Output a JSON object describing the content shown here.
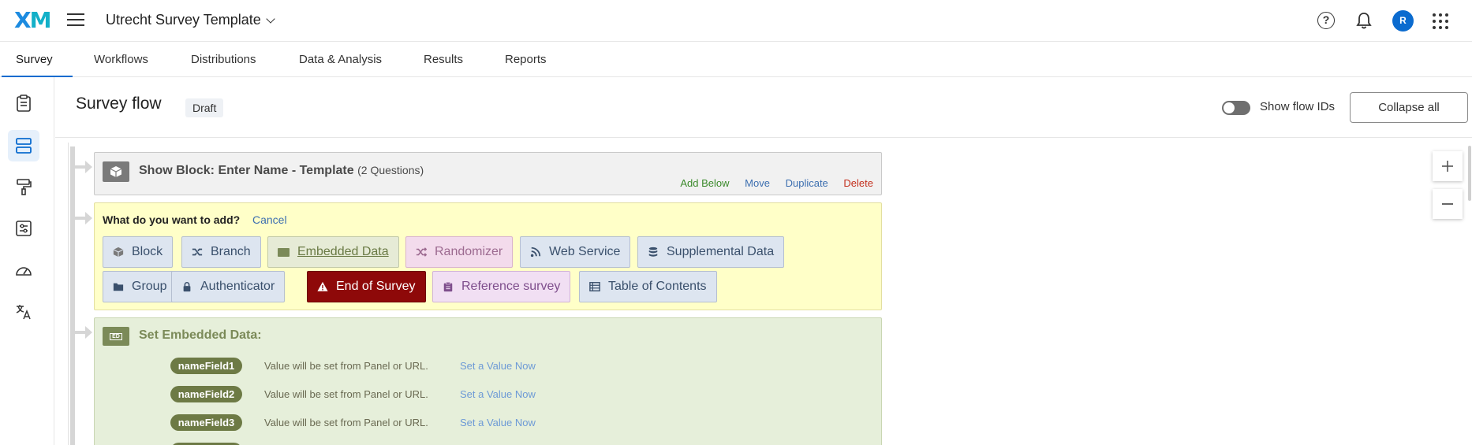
{
  "app": {
    "logo_x": "X",
    "logo_m": "M",
    "project_title": "Utrecht Survey Template",
    "avatar_initial": "R"
  },
  "tabs": [
    {
      "label": "Survey",
      "active": true
    },
    {
      "label": "Workflows"
    },
    {
      "label": "Distributions"
    },
    {
      "label": "Data & Analysis"
    },
    {
      "label": "Results"
    },
    {
      "label": "Reports"
    }
  ],
  "rail": [
    "clipboard-icon",
    "survey-flow-icon",
    "paint-roller-icon",
    "sliders-icon",
    "gauge-icon",
    "translate-icon"
  ],
  "header": {
    "title": "Survey flow",
    "badge": "Draft",
    "toggle_label": "Show flow IDs",
    "toggle_on": false,
    "collapse_label": "Collapse all"
  },
  "show_block": {
    "title": "Show Block: Enter Name - Template",
    "subtitle": "(2 Questions)",
    "actions": {
      "add_below": "Add Below",
      "move": "Move",
      "duplicate": "Duplicate",
      "delete": "Delete"
    }
  },
  "add_panel": {
    "question": "What do you want to add?",
    "cancel": "Cancel",
    "options": [
      {
        "label": "Block",
        "icon": "cube-icon"
      },
      {
        "label": "Branch",
        "icon": "branch-icon"
      },
      {
        "label": "Embedded Data",
        "icon": "ed-icon"
      },
      {
        "label": "Randomizer",
        "icon": "shuffle-icon"
      },
      {
        "label": "Web Service",
        "icon": "rss-icon"
      },
      {
        "label": "Supplemental Data",
        "icon": "database-icon"
      },
      {
        "label": "Group",
        "icon": "folder-icon"
      },
      {
        "label": "Authenticator",
        "icon": "lock-icon"
      },
      {
        "label": "End of Survey",
        "icon": "warning-icon"
      },
      {
        "label": "Reference survey",
        "icon": "clipboard-icon"
      },
      {
        "label": "Table of Contents",
        "icon": "list-icon"
      }
    ]
  },
  "embedded_data": {
    "title": "Set Embedded Data:",
    "fields": [
      {
        "name": "nameField1",
        "desc": "Value will be set from Panel or URL.",
        "link": "Set a Value Now"
      },
      {
        "name": "nameField2",
        "desc": "Value will be set from Panel or URL.",
        "link": "Set a Value Now"
      },
      {
        "name": "nameField3",
        "desc": "Value will be set from Panel or URL.",
        "link": "Set a Value Now"
      }
    ]
  },
  "colors": {
    "accent": "#0b6bcf",
    "end_of_survey": "#8e0909",
    "embedded_pill": "#6d7a45",
    "add_panel_bg": "#ffffc8"
  }
}
